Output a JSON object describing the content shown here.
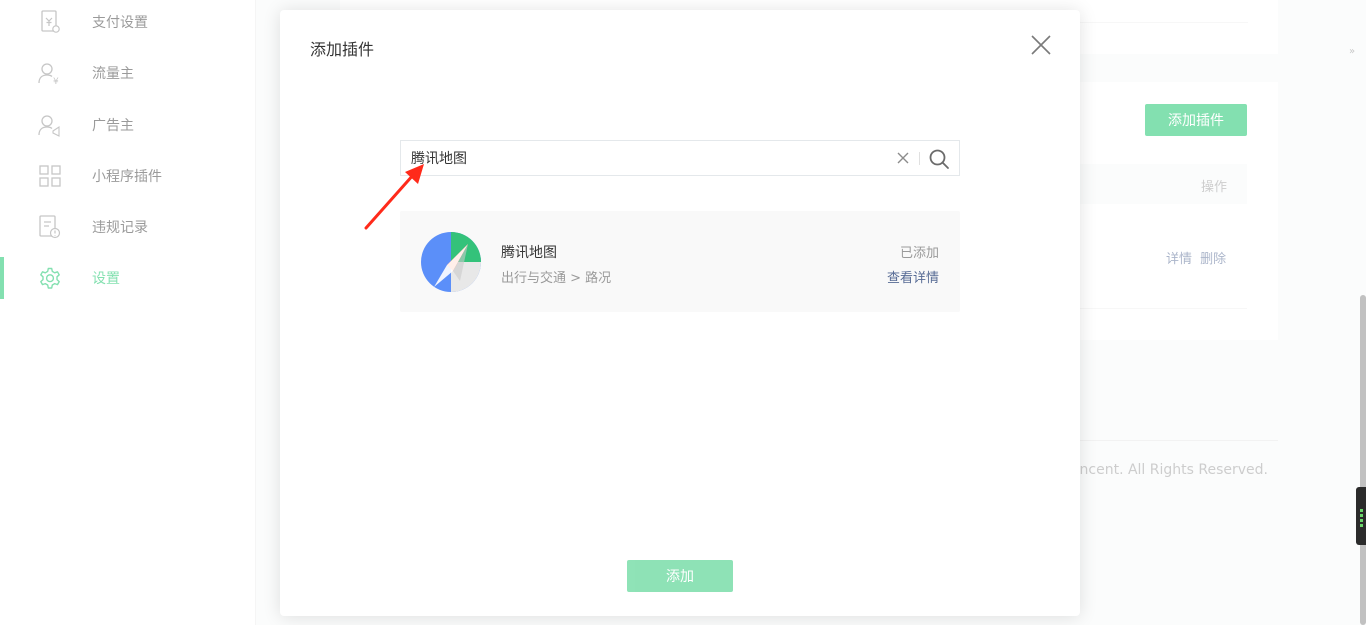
{
  "sidebar": {
    "items": [
      {
        "label": "支付设置",
        "icon": "payment-settings-icon"
      },
      {
        "label": "流量主",
        "icon": "traffic-owner-icon"
      },
      {
        "label": "广告主",
        "icon": "advertiser-icon"
      },
      {
        "label": "小程序插件",
        "icon": "miniprogram-plugin-icon"
      },
      {
        "label": "违规记录",
        "icon": "violation-record-icon"
      },
      {
        "label": "设置",
        "icon": "settings-gear-icon",
        "active": true
      }
    ]
  },
  "background": {
    "add_plugin_label": "添加插件",
    "table_header_op": "操作",
    "row_ops": [
      "详情",
      "删除"
    ],
    "copyright": "Tencent. All Rights Reserved."
  },
  "dialog": {
    "title": "添加插件",
    "search": {
      "value": "腾讯地图"
    },
    "result": {
      "name": "腾讯地图",
      "category": "出行与交通 > 路况",
      "status": "已添加",
      "detail_link": "查看详情"
    },
    "add_button": "添加"
  },
  "colors": {
    "brand": "#07c160",
    "link": "#576b95",
    "annotation_arrow": "#ff2a1a"
  }
}
